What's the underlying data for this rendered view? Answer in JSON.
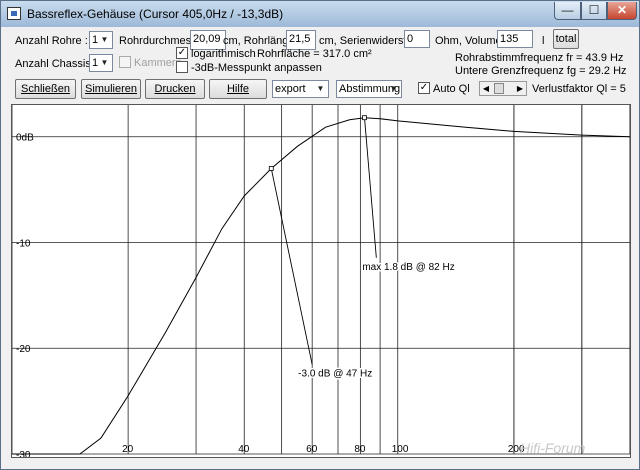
{
  "window": {
    "title": "Bassreflex-Gehäuse (Cursor 405,0Hz / -13,3dB)",
    "min_glyph": "—",
    "max_glyph": "☐",
    "close_glyph": "✕"
  },
  "row1": {
    "rohre_label": "Anzahl Rohre :",
    "rohre_value": "1",
    "rohrdurchmesser_label": "Rohrdurchmesser",
    "rohrdurchmesser_value": "20,09",
    "rohrlaenge_label": "cm, Rohrlänge",
    "rohrlaenge_value": "21,5",
    "serienwiderstand_label": "cm, Serienwiderstand",
    "serienwiderstand_value": "0",
    "volumen_label": "Ohm, Volumen",
    "volumen_value": "135",
    "volumen_unit": "l",
    "total_label": "total"
  },
  "row2": {
    "chassis_label": "Anzahl Chassis :",
    "chassis_value": "1",
    "kammern_label": "Kammern",
    "logarithmisch_label": "logarithmisch",
    "rohrflaeche_text": "Rohrfläche = 317.0 cm²",
    "messpunkt_label": "-3dB-Messpunkt anpassen",
    "rohrabstimm_text": "Rohrabstimmfrequenz fr = 43.9 Hz",
    "grenzfrequenz_text": "Untere Grenzfrequenz fg = 29.2 Hz"
  },
  "toolbar": {
    "schliessen": "Schließen",
    "simulieren": "Simulieren",
    "drucken": "Drucken",
    "hilfe": "Hilfe",
    "export_value": "export",
    "abstimmung_value": "Abstimmung",
    "autoql_label": "Auto Ql",
    "verlustfaktor_text": "Verlustfaktor Ql = 5"
  },
  "chart_data": {
    "type": "line",
    "title": "",
    "xlabel": "",
    "ylabel": "",
    "xscale": "log",
    "xlim": [
      10,
      400
    ],
    "ylim": [
      -30,
      3
    ],
    "x_ticks": [
      20,
      40,
      60,
      80,
      100,
      200
    ],
    "y_ticks": [
      {
        "value": 0,
        "label": "0dB"
      },
      {
        "value": -10,
        "label": "-10"
      },
      {
        "value": -20,
        "label": "-20"
      },
      {
        "value": -30,
        "label": "-30"
      }
    ],
    "grid": true,
    "series": [
      {
        "name": "",
        "color": "#000000",
        "x": [
          10,
          15,
          17,
          20,
          25,
          30,
          35,
          40,
          47,
          55,
          65,
          75,
          82,
          90,
          100,
          150,
          200,
          300,
          400
        ],
        "y": [
          -30,
          -30,
          -28.5,
          -24.5,
          -18.5,
          -13.3,
          -8.7,
          -5.6,
          -3.0,
          -0.9,
          0.9,
          1.6,
          1.8,
          1.7,
          1.5,
          0.9,
          0.5,
          0.15,
          0
        ]
      }
    ],
    "annotations": [
      {
        "text": "-3.0 dB @ 47 Hz",
        "x": 47,
        "y": -3.0,
        "label_x": 60,
        "label_y": -22.3
      },
      {
        "text": "max 1.8 dB @ 82 Hz",
        "x": 82,
        "y": 1.8,
        "label_x": 88,
        "label_y": -12.2
      }
    ],
    "watermark": "Hifi-Forum"
  }
}
